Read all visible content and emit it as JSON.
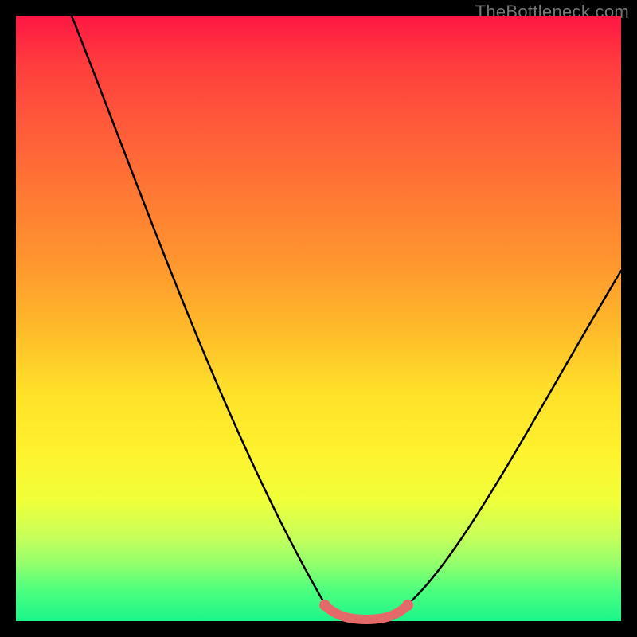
{
  "watermark": "TheBottleneck.com",
  "colors": {
    "bg": "#000000",
    "gradient_top": "#ff1744",
    "gradient_bottom": "#1cf58a",
    "curve": "#000000",
    "highlight": "#e46a6a"
  },
  "chart_data": {
    "type": "line",
    "title": "",
    "xlabel": "",
    "ylabel": "",
    "xlim": [
      0,
      100
    ],
    "ylim": [
      0,
      100
    ],
    "grid": false,
    "series": [
      {
        "name": "bottleneck-curve",
        "x": [
          0,
          10,
          20,
          30,
          40,
          48,
          52,
          56,
          60,
          64,
          70,
          80,
          90,
          100
        ],
        "y": [
          100,
          82,
          64,
          46,
          28,
          10,
          2,
          0,
          0,
          2,
          10,
          28,
          44,
          56
        ]
      }
    ],
    "annotations": [
      {
        "name": "optimal-zone",
        "x_start": 52,
        "x_end": 64,
        "y": 0
      }
    ]
  }
}
